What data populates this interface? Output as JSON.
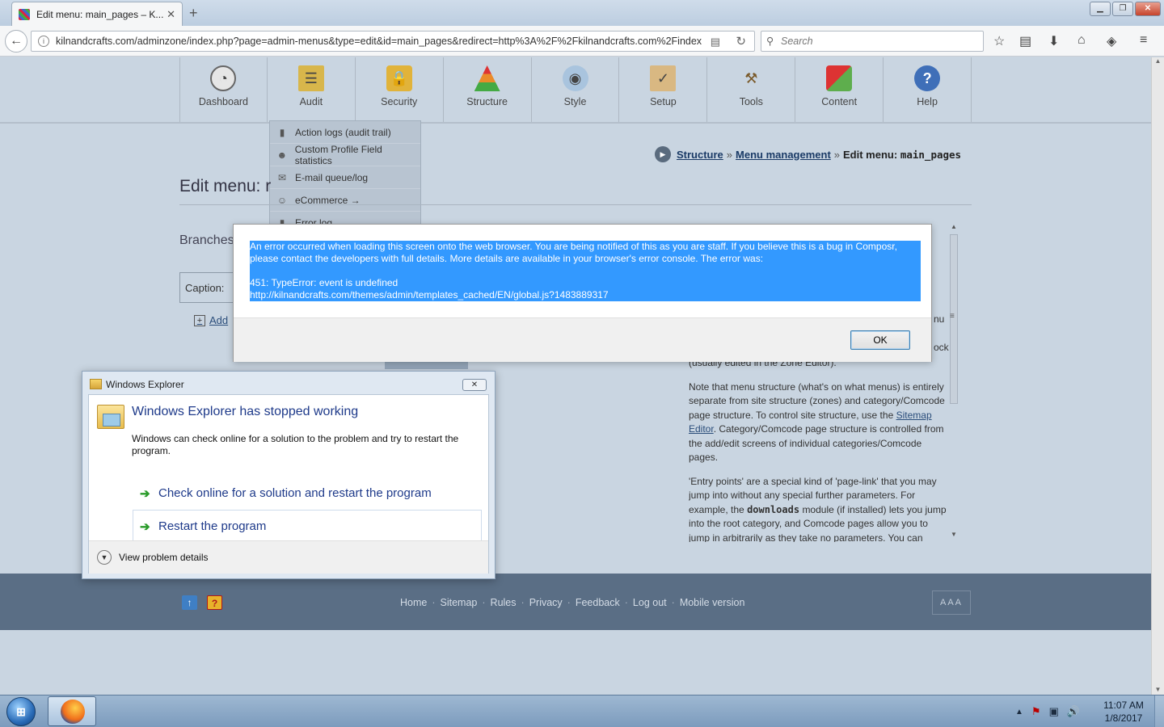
{
  "browser": {
    "tab_title": "Edit menu: main_pages – K...",
    "url": "kilnandcrafts.com/adminzone/index.php?page=admin-menus&type=edit&id=main_pages&redirect=http%3A%2F%2Fkilnandcrafts.com%2Findex.p",
    "search_placeholder": "Search"
  },
  "topnav": [
    {
      "label": "Dashboard",
      "color": "#c3c9d0"
    },
    {
      "label": "Audit",
      "color": "#d8b64b"
    },
    {
      "label": "Security",
      "color": "#e1b33a"
    },
    {
      "label": "Structure",
      "color": "#ea8b2a"
    },
    {
      "label": "Style",
      "color": "#7fa6c9"
    },
    {
      "label": "Setup",
      "color": "#d9b882"
    },
    {
      "label": "Tools",
      "color": "#b48a4a"
    },
    {
      "label": "Content",
      "color": "#5eae4d"
    },
    {
      "label": "Help",
      "color": "#3f6fb8"
    }
  ],
  "audit_menu": [
    "Action logs (audit trail)",
    "Custom Profile Field statistics",
    "E-mail queue/log",
    "eCommerce →",
    "Error log"
  ],
  "breadcrumb": {
    "structure": "Structure",
    "sep": "»",
    "menu_management": "Menu management",
    "current_prefix": "Edit menu:",
    "current_code": "main_pages"
  },
  "page": {
    "title": "Edit menu: r",
    "branches": "Branches",
    "caption_label": "Caption:",
    "add_label": "Add"
  },
  "help": {
    "frag_menu": "nu",
    "frag_block": "ock",
    "p0": "(usually edited in the Zone Editor).",
    "p1_a": "Note that menu structure (what's on what menus) is entirely separate from site structure (zones) and category/Comcode page structure. To control site structure, use the",
    "p1_link1": "Sitemap",
    "p1_link2": "Editor",
    "p1_b": ". Category/Comcode page structure is controlled from the add/edit screens of individual categories/Comcode pages.",
    "p2_a": "'Entry points' are a special kind of 'page-link' that you may jump into without any special further parameters. For example, the",
    "p2_code": "downloads",
    "p2_b": "module (if installed) lets you jump into the root category, and Comcode pages allow you to jump in arbitrarily as they take no parameters. You can"
  },
  "footer": {
    "links": [
      "Home",
      "Sitemap",
      "Rules",
      "Privacy",
      "Feedback",
      "Log out",
      "Mobile version"
    ],
    "sep": "·",
    "font_size": "AAA"
  },
  "alert": {
    "line1": "An error occurred when loading this screen onto the web browser. You are being notified of this as you are staff. If you believe this is a bug in Composr,",
    "line2": "please contact the developers with full details. More details are available in your browser's error console. The error was:",
    "line3": "451: TypeError: event is undefined",
    "line4": "http://kilnandcrafts.com/themes/admin/templates_cached/EN/global.js?1483889317",
    "ok": "OK"
  },
  "wer": {
    "title": "Windows Explorer",
    "headline": "Windows Explorer has stopped working",
    "desc": "Windows can check online for a solution to the problem and try to restart the program.",
    "opt1": "Check online for a solution and restart the program",
    "opt2": "Restart the program",
    "details": "View problem details"
  },
  "taskbar": {
    "time": "11:07 AM",
    "date": "1/8/2017"
  }
}
